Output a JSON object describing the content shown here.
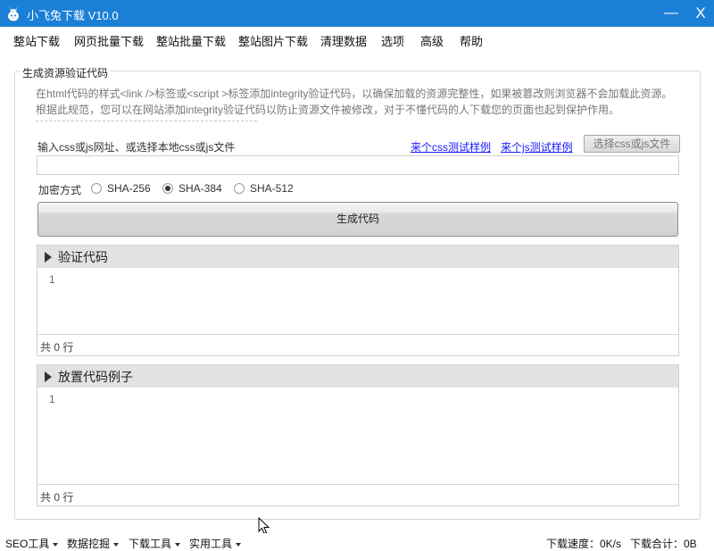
{
  "window": {
    "title": "小飞兔下载 V10.0",
    "min_glyph": "—",
    "close_glyph": "X"
  },
  "menu": {
    "items": [
      {
        "label": "整站下载"
      },
      {
        "label": "网页批量下载"
      },
      {
        "label": "整站批量下载"
      },
      {
        "label": "整站图片下载"
      },
      {
        "label": "清理数据"
      },
      {
        "label": "选项"
      },
      {
        "label": "高级"
      },
      {
        "label": "帮助"
      }
    ]
  },
  "group": {
    "title": "生成资源验证代码",
    "desc_line1": "在html代码的样式<link />标签或<script >标签添加integrity验证代码，以确保加载的资源完整性，如果被篡改则浏览器不会加载此资源。",
    "desc_line2": "根据此规范，您可以在网站添加integrity验证代码以防止资源文件被修改，对于不懂代码的人下载您的页面也起到保护作用。"
  },
  "input": {
    "label": "输入css或js网址、或选择本地css或js文件",
    "css_sample_link": "来个css测试样例",
    "js_sample_link": "来个js测试样例",
    "choose_button": "选择css或js文件",
    "value": "",
    "placeholder": ""
  },
  "encryption": {
    "label": "加密方式",
    "options": [
      {
        "label": "SHA-256",
        "selected": false
      },
      {
        "label": "SHA-384",
        "selected": true
      },
      {
        "label": "SHA-512",
        "selected": false
      }
    ]
  },
  "generate_button": "生成代码",
  "panels": [
    {
      "title": "验证代码",
      "line_number": "1",
      "footer": "共 0 行"
    },
    {
      "title": "放置代码例子",
      "line_number": "1",
      "footer": "共 0 行"
    }
  ],
  "statusbar": {
    "menus": [
      {
        "label": "SEO工具"
      },
      {
        "label": "数据挖掘"
      },
      {
        "label": "下载工具"
      },
      {
        "label": "实用工具"
      }
    ],
    "speed": "下载速度：0K/s",
    "total": "下载合计：0B"
  },
  "icons": {
    "logo": "rabbit-logo-icon",
    "minimize": "minimize-icon",
    "close": "close-icon",
    "expand": "triangle-right-icon",
    "dropdown": "caret-down-icon",
    "cursor": "mouse-pointer-icon"
  }
}
